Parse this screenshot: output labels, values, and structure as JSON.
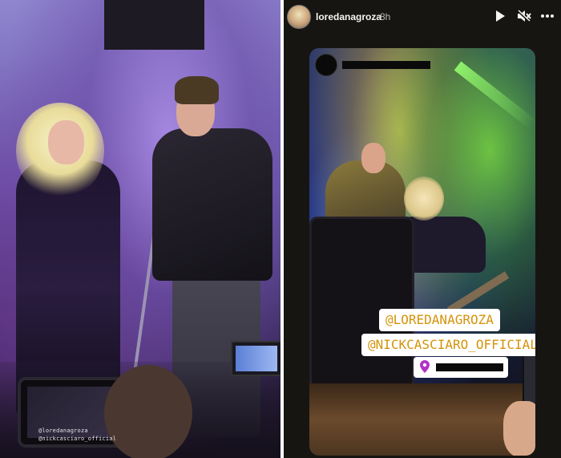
{
  "left_photo": {
    "caption_lines": [
      "@loredanagroza",
      "@nickcasciaro_official"
    ]
  },
  "story": {
    "header": {
      "username": "loredanagroza",
      "time": "8h",
      "icons": [
        "play-icon",
        "mute-icon",
        "more-icon"
      ]
    },
    "tags": {
      "tag_1": "@LOREDANAGROZA",
      "tag_2": "@NICKCASCIARO_OFFICIAL"
    },
    "colors": {
      "tag_text": "#d4930a",
      "location_pin": "#b233c7"
    }
  }
}
